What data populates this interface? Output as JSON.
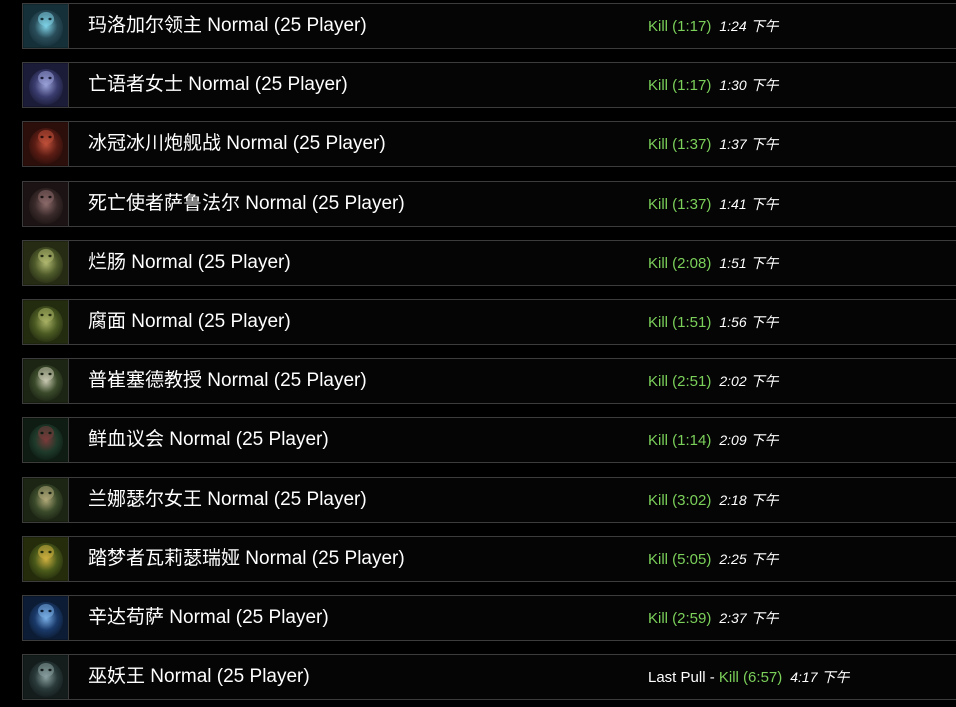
{
  "encounters": [
    {
      "name": "玛洛加尔领主 Normal (25 Player)",
      "result": "Kill (1:17)",
      "time": "1:24 下午",
      "colors": [
        "#2a4d5a",
        "#7fd4e8",
        "#163039"
      ]
    },
    {
      "name": "亡语者女士 Normal (25 Player)",
      "result": "Kill (1:17)",
      "time": "1:30 下午",
      "colors": [
        "#3a3c6e",
        "#9aa2d8",
        "#1b1c38"
      ]
    },
    {
      "name": "冰冠冰川炮舰战 Normal (25 Player)",
      "result": "Kill (1:37)",
      "time": "1:37 下午",
      "colors": [
        "#5a1c14",
        "#c0503a",
        "#2c0e0a"
      ]
    },
    {
      "name": "死亡使者萨鲁法尔 Normal (25 Player)",
      "result": "Kill (1:37)",
      "time": "1:41 下午",
      "colors": [
        "#3a2a2a",
        "#8c6a6a",
        "#1c1414"
      ]
    },
    {
      "name": "烂肠 Normal (25 Player)",
      "result": "Kill (2:08)",
      "time": "1:51 下午",
      "colors": [
        "#4e5a2a",
        "#b0b870",
        "#262c14"
      ]
    },
    {
      "name": "腐面 Normal (25 Player)",
      "result": "Kill (1:51)",
      "time": "1:56 下午",
      "colors": [
        "#4a5a22",
        "#a8b064",
        "#242c10"
      ]
    },
    {
      "name": "普崔塞德教授 Normal (25 Player)",
      "result": "Kill (2:51)",
      "time": "2:02 下午",
      "colors": [
        "#3a4a2a",
        "#c8c8b0",
        "#1c2414"
      ]
    },
    {
      "name": "鲜血议会 Normal (25 Player)",
      "result": "Kill (1:14)",
      "time": "2:09 下午",
      "colors": [
        "#1e3a2a",
        "#7a3a3a",
        "#0e1c14"
      ]
    },
    {
      "name": "兰娜瑟尔女王 Normal (25 Player)",
      "result": "Kill (3:02)",
      "time": "2:18 下午",
      "colors": [
        "#3a4a2a",
        "#b0a878",
        "#1c2414"
      ]
    },
    {
      "name": "踏梦者瓦莉瑟瑞娅 Normal (25 Player)",
      "result": "Kill (5:05)",
      "time": "2:25 下午",
      "colors": [
        "#4a5a1a",
        "#d0b040",
        "#242c0c"
      ]
    },
    {
      "name": "辛达苟萨 Normal (25 Player)",
      "result": "Kill (2:59)",
      "time": "2:37 下午",
      "colors": [
        "#1a3a6a",
        "#7ab0e8",
        "#0c1c34"
      ]
    },
    {
      "name": "巫妖王 Normal (25 Player)",
      "prefix": "Last Pull",
      "separator": " - ",
      "result": "Kill (6:57)",
      "time": "4:17 下午",
      "colors": [
        "#2a3a3a",
        "#8aa0a0",
        "#141c1c"
      ]
    }
  ]
}
